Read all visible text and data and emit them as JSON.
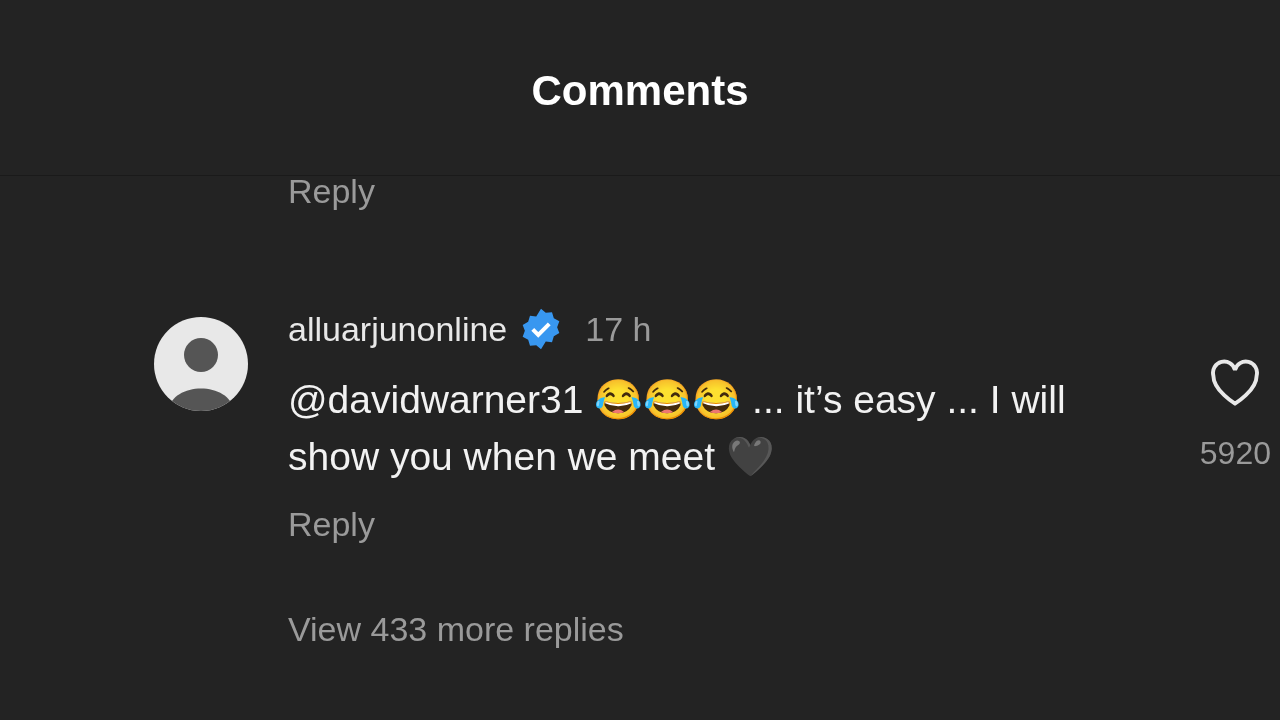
{
  "header": {
    "title": "Comments"
  },
  "previous_reply": "Reply",
  "comment": {
    "username": "alluarjunonline",
    "verified": true,
    "time": "17 h",
    "text": "@davidwarner31 😂😂😂 ... it’s easy ... I will show you when we meet 🖤",
    "likes": "5920",
    "liked": false,
    "reply": "Reply",
    "view_replies": "View 433 more replies"
  }
}
